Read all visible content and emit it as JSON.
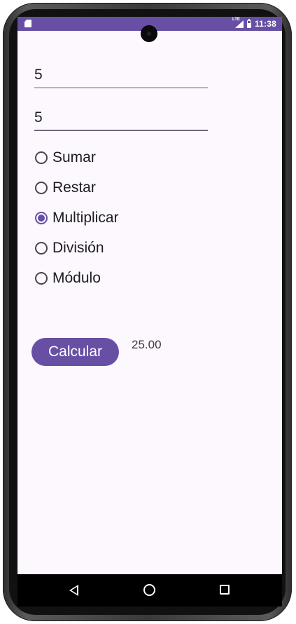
{
  "status_bar": {
    "time": "11:38",
    "network": "LTE",
    "background": "#6750a4"
  },
  "form": {
    "field1_value": "5",
    "field2_value": "5"
  },
  "operations": [
    {
      "label": "Sumar",
      "checked": false
    },
    {
      "label": "Restar",
      "checked": false
    },
    {
      "label": "Multiplicar",
      "checked": true
    },
    {
      "label": "División",
      "checked": false
    },
    {
      "label": "Módulo",
      "checked": false
    }
  ],
  "actions": {
    "calculate_label": "Calcular"
  },
  "result": {
    "value": "25.00"
  },
  "navigation": {
    "back": "back-triangle-icon",
    "home": "home-circle-icon",
    "recents": "recents-square-icon"
  },
  "colors": {
    "accent": "#6750a4",
    "screen_background": "#fdf7fe",
    "text": "#1c1b1f"
  }
}
